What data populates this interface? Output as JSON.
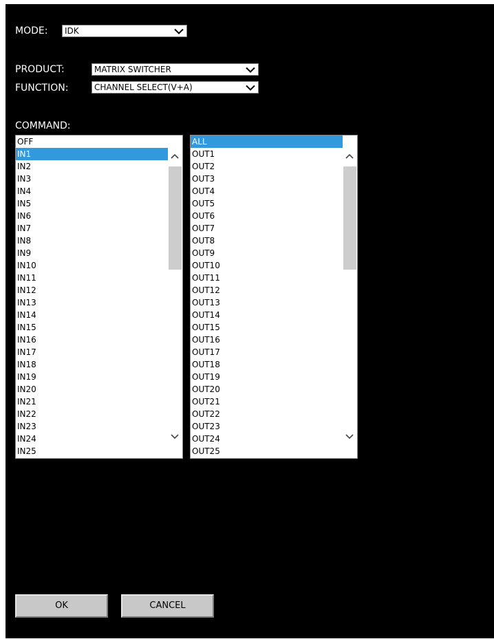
{
  "mode": {
    "label": "MODE:",
    "value": "IDK"
  },
  "product": {
    "label": "PRODUCT:",
    "value": "MATRIX SWITCHER"
  },
  "function": {
    "label": "FUNCTION:",
    "value": "CHANNEL SELECT(V+A)"
  },
  "command": {
    "label": "COMMAND:"
  },
  "inputs": {
    "items": [
      "OFF",
      "IN1",
      "IN2",
      "IN3",
      "IN4",
      "IN5",
      "IN6",
      "IN7",
      "IN8",
      "IN9",
      "IN10",
      "IN11",
      "IN12",
      "IN13",
      "IN14",
      "IN15",
      "IN16",
      "IN17",
      "IN18",
      "IN19",
      "IN20",
      "IN21",
      "IN22",
      "IN23",
      "IN24",
      "IN25"
    ],
    "selected": "IN1"
  },
  "outputs": {
    "items": [
      "ALL",
      "OUT1",
      "OUT2",
      "OUT3",
      "OUT4",
      "OUT5",
      "OUT6",
      "OUT7",
      "OUT8",
      "OUT9",
      "OUT10",
      "OUT11",
      "OUT12",
      "OUT13",
      "OUT14",
      "OUT15",
      "OUT16",
      "OUT17",
      "OUT18",
      "OUT19",
      "OUT20",
      "OUT21",
      "OUT22",
      "OUT23",
      "OUT24",
      "OUT25"
    ],
    "selected": "ALL"
  },
  "buttons": {
    "ok_label": "OK",
    "cancel_label": "CANCEL"
  },
  "colors": {
    "background": "#000000",
    "selection": "#3399dd",
    "button": "#c8c8c8"
  },
  "icons": {
    "dropdown": "chevron-down-icon",
    "scroll_up": "chevron-up-icon",
    "scroll_down": "chevron-down-icon"
  }
}
